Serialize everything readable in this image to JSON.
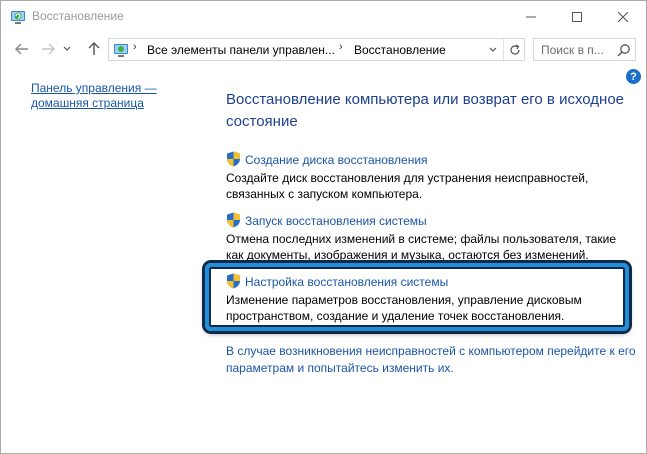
{
  "window": {
    "title": "Восстановление",
    "icon": "recovery-icon"
  },
  "titlebar_buttons": {
    "minimize_icon": "minimize-icon",
    "maximize_icon": "maximize-icon",
    "close_icon": "close-icon"
  },
  "nav": {
    "back_icon": "arrow-left-icon",
    "forward_icon": "arrow-right-icon",
    "recent_icon": "chevron-down-icon",
    "up_icon": "arrow-up-icon"
  },
  "address": {
    "crumbs": [
      "Все элементы панели управлен...",
      "Восстановление"
    ],
    "separator": "›",
    "dropdown_icon": "chevron-down-icon",
    "refresh_icon": "refresh-icon"
  },
  "search": {
    "placeholder": "Поиск в п...",
    "value": ""
  },
  "sidebar": {
    "home_link": "Панель управления — домашняя страница"
  },
  "main": {
    "title": "Восстановление компьютера или возврат его в исходное состояние",
    "tasks": [
      {
        "link": "Создание диска восстановления",
        "description": "Создайте диск восстановления для устранения неисправностей, связанных с запуском компьютера."
      },
      {
        "link": "Запуск восстановления системы",
        "description": "Отмена последних изменений в системе; файлы пользователя, такие как документы, изображения и музыка, остаются без изменений."
      },
      {
        "link": "Настройка восстановления системы",
        "description": "Изменение параметров восстановления, управление дисковым пространством, создание и удаление точек восстановления."
      }
    ],
    "footer_link": "В случае возникновения неисправностей с компьютером перейдите к его параметрам и попытайтесь изменить их."
  },
  "help": {
    "label": "?"
  },
  "colors": {
    "link": "#1a55a6",
    "title": "#1e3f8c",
    "highlight_border": "#1f8fd9",
    "shield_blue": "#2b6cc4",
    "shield_yellow": "#f2c12e"
  }
}
